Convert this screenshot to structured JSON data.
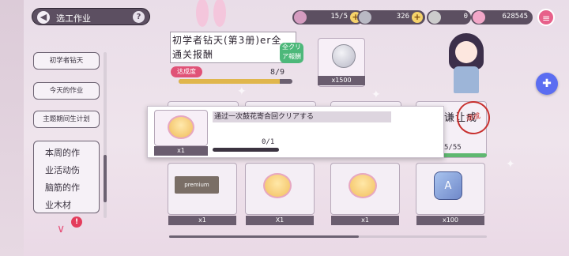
{
  "header": {
    "title": "选工作业",
    "help": "?"
  },
  "resources": [
    {
      "icon": "pink-coin-icon",
      "value": "15/5"
    },
    {
      "icon": "silver-coin-icon",
      "value": "326"
    },
    {
      "icon": "gray-token-icon",
      "value": "0"
    },
    {
      "icon": "pink-gem-icon",
      "value": "628545"
    }
  ],
  "menu_icon": "hamburger-menu-icon",
  "chat_icon": "chat-bubble-icon",
  "sidebar": {
    "items": [
      {
        "label": "初学者钻天"
      },
      {
        "label": "今天的作业"
      },
      {
        "label": "主题期间生计划"
      },
      {
        "label": "本周的作业活动伤脑筋的作业木材"
      }
    ],
    "badge": "!"
  },
  "quest": {
    "title": "初学者钻天(第3册)er全通关报酬",
    "clear_badge": "全クリア報酬",
    "progress_label": "达成度",
    "progress_value": "8/9",
    "progress_fraction": 0.89,
    "reward_qty": "x1500"
  },
  "row2": {
    "done_label": "谦让成",
    "stamp": "達成",
    "count": "5/55"
  },
  "cards": [
    {
      "icon": "premium-ticket-icon",
      "label": "premium",
      "qty": "x1"
    },
    {
      "icon": "pudding-icon",
      "qty": "X1"
    },
    {
      "icon": "pudding-icon",
      "qty": "x1"
    },
    {
      "icon": "puzzle-piece-icon",
      "qty": "x100"
    }
  ],
  "popup": {
    "qty": "x1",
    "description": "通过一次鼓花寄合回クリアする",
    "progress": "0/1",
    "progress_fraction": 0
  }
}
